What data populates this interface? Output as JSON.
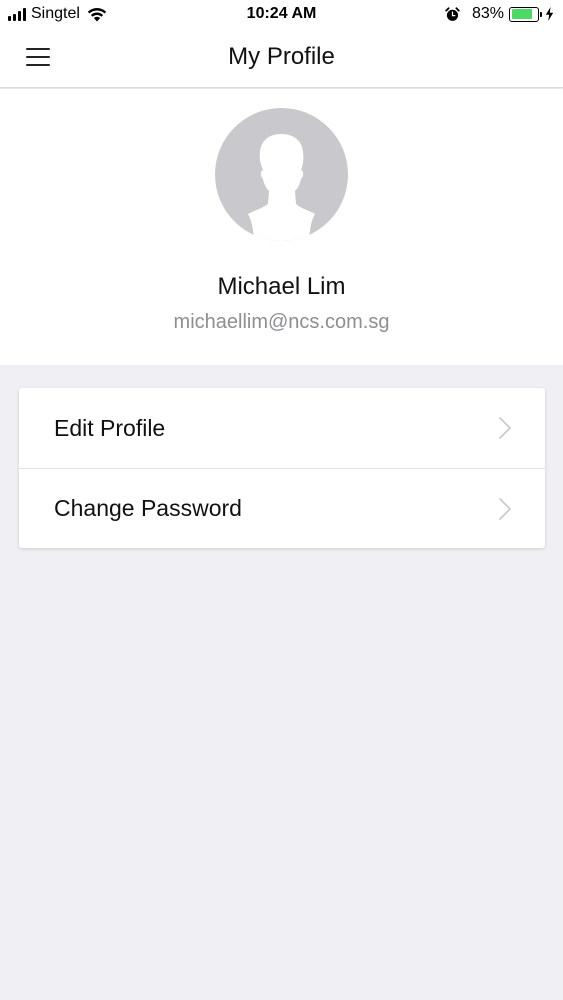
{
  "status_bar": {
    "carrier": "Singtel",
    "time": "10:24 AM",
    "battery_percent": "83%",
    "battery_level": 0.83,
    "battery_color": "#4cd964",
    "icons": [
      "signal-icon",
      "wifi-icon",
      "alarm-icon",
      "battery-icon",
      "charging-bolt-icon"
    ]
  },
  "header": {
    "title": "My Profile",
    "menu_icon": "hamburger-menu-icon"
  },
  "profile": {
    "avatar_icon": "default-user-silhouette-icon",
    "name": "Michael Lim",
    "email": "michaellim@ncs.com.sg"
  },
  "menu": {
    "items": [
      {
        "label": "Edit Profile",
        "icon": "chevron-right-icon"
      },
      {
        "label": "Change Password",
        "icon": "chevron-right-icon"
      }
    ]
  },
  "colors": {
    "background": "#f0eff4",
    "card": "#ffffff",
    "secondary_text": "#8e8e93",
    "avatar_bg": "#c9c8cd"
  }
}
